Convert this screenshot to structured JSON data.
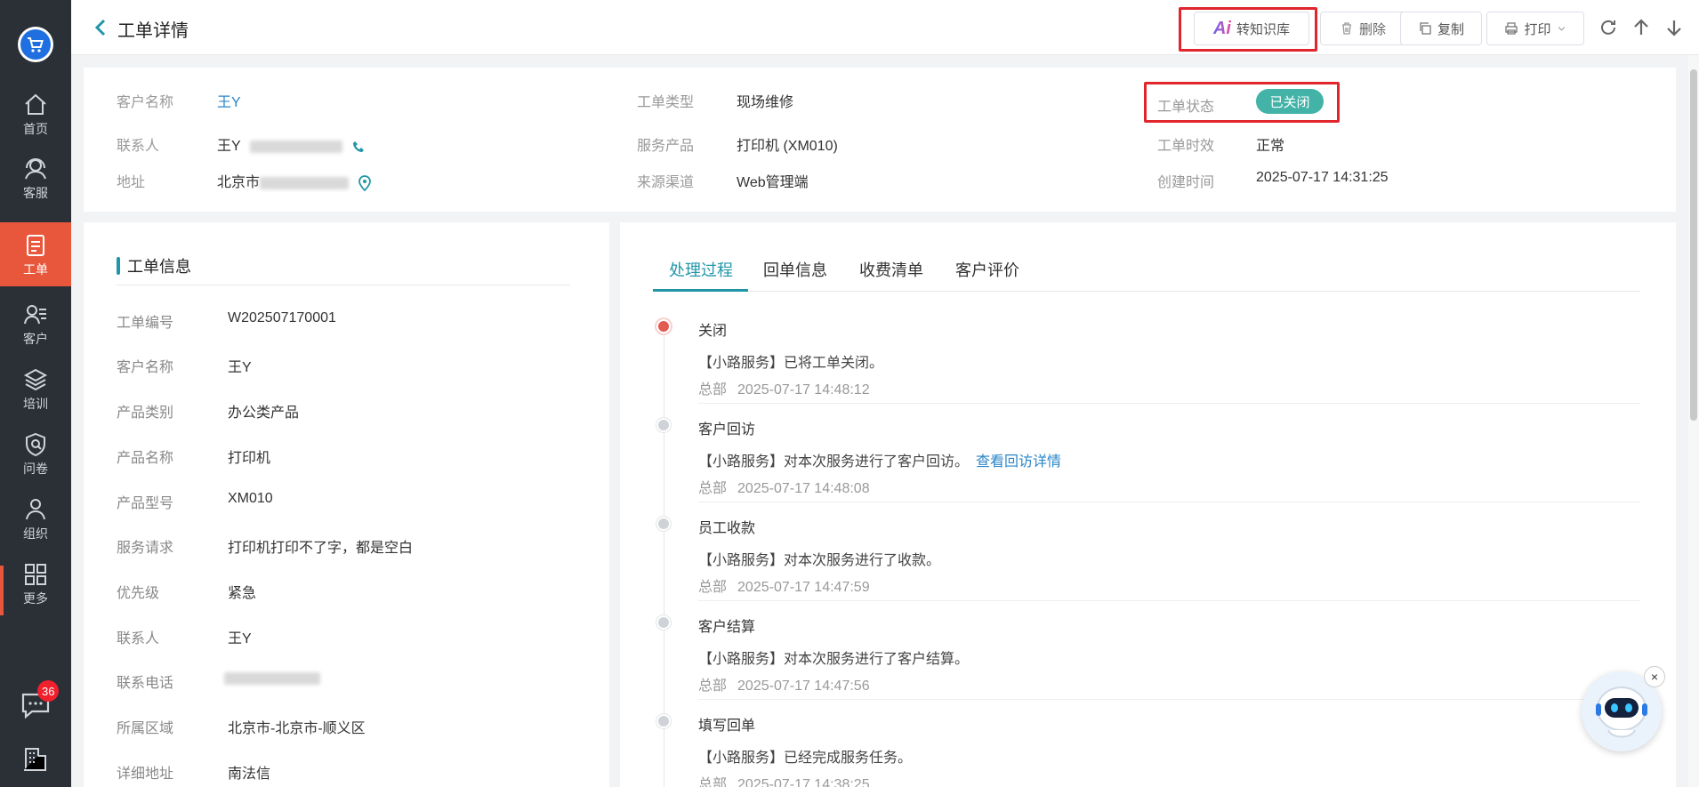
{
  "sidebar": {
    "badge_count": "36",
    "items": [
      {
        "label": "首页",
        "icon": "home-icon"
      },
      {
        "label": "客服",
        "icon": "headset-icon"
      },
      {
        "label": "工单",
        "icon": "ticket-icon"
      },
      {
        "label": "客户",
        "icon": "customer-icon"
      },
      {
        "label": "培训",
        "icon": "layers-icon"
      },
      {
        "label": "问卷",
        "icon": "survey-icon"
      },
      {
        "label": "组织",
        "icon": "team-icon"
      },
      {
        "label": "更多",
        "icon": "grid-icon"
      }
    ]
  },
  "header": {
    "title": "工单详情",
    "kb_label": "转知识库",
    "ai_mark": "Ai",
    "delete_label": "删除",
    "copy_label": "复制",
    "print_label": "打印"
  },
  "summary": {
    "customer_label": "客户名称",
    "customer_value": "王Y",
    "contact_label": "联系人",
    "contact_value": "王Y",
    "address_label": "地址",
    "address_value": "北京市",
    "type_label": "工单类型",
    "type_value": "现场维修",
    "product_label": "服务产品",
    "product_value": "打印机 (XM010)",
    "channel_label": "来源渠道",
    "channel_value": "Web管理端",
    "status_label": "工单状态",
    "status_value": "已关闭",
    "sla_label": "工单时效",
    "sla_value": "正常",
    "created_label": "创建时间",
    "created_value": "2025-07-17 14:31:25"
  },
  "info": {
    "title": "工单信息",
    "rows": [
      {
        "label": "工单编号",
        "value": "W202507170001"
      },
      {
        "label": "客户名称",
        "value": "王Y"
      },
      {
        "label": "产品类别",
        "value": "办公类产品"
      },
      {
        "label": "产品名称",
        "value": "打印机"
      },
      {
        "label": "产品型号",
        "value": "XM010"
      },
      {
        "label": "服务请求",
        "value": "打印机打印不了字，都是空白"
      },
      {
        "label": "优先级",
        "value": "紧急"
      },
      {
        "label": "联系人",
        "value": "王Y"
      },
      {
        "label": "联系电话",
        "value": ""
      },
      {
        "label": "所属区域",
        "value": "北京市-北京市-顺义区"
      },
      {
        "label": "详细地址",
        "value": "南法信"
      }
    ]
  },
  "process": {
    "tabs": [
      "处理过程",
      "回单信息",
      "收费清单",
      "客户评价"
    ],
    "events": [
      {
        "title": "关闭",
        "desc": "【小路服务】已将工单关闭。",
        "link": "",
        "org": "总部",
        "time": "2025-07-17 14:48:12"
      },
      {
        "title": "客户回访",
        "desc": "【小路服务】对本次服务进行了客户回访。",
        "link": "查看回访详情",
        "org": "总部",
        "time": "2025-07-17 14:48:08"
      },
      {
        "title": "员工收款",
        "desc": "【小路服务】对本次服务进行了收款。",
        "link": "",
        "org": "总部",
        "time": "2025-07-17 14:47:59"
      },
      {
        "title": "客户结算",
        "desc": "【小路服务】对本次服务进行了客户结算。",
        "link": "",
        "org": "总部",
        "time": "2025-07-17 14:47:56"
      },
      {
        "title": "填写回单",
        "desc": "【小路服务】已经完成服务任务。",
        "link": "",
        "org": "总部",
        "time": "2025-07-17 14:38:25"
      }
    ]
  },
  "colors": {
    "accent": "#2196a8",
    "sidebar_active": "#e8573c",
    "status_pill": "#43b3a8",
    "highlight_box": "#e0252c"
  }
}
